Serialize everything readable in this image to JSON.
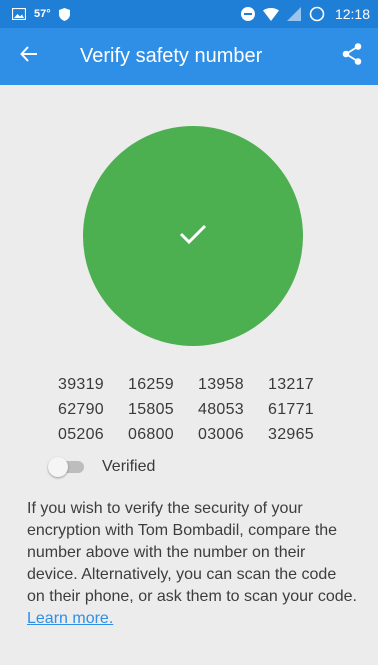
{
  "status_bar": {
    "temperature": "57°",
    "time": "12:18",
    "icons": [
      "image-icon",
      "shield-icon",
      "do-not-disturb-icon",
      "wifi-icon",
      "signal-icon",
      "battery-icon"
    ]
  },
  "app_bar": {
    "title": "Verify safety number",
    "back_icon": "arrow-back-icon",
    "share_icon": "share-icon",
    "color": "#2f8ee5"
  },
  "qr": {
    "state": "verified",
    "color": "#4caf50",
    "icon": "check-icon"
  },
  "safety_number": {
    "groups": [
      "39319",
      "16259",
      "13958",
      "13217",
      "62790",
      "15805",
      "48053",
      "61771",
      "05206",
      "06800",
      "03006",
      "32965"
    ]
  },
  "verified_toggle": {
    "label": "Verified",
    "checked": false
  },
  "description": {
    "text": "If you wish to verify the security of your encryption with Tom Bombadil, compare the number above with the number on their device. Alternatively, you can scan the code on their phone, or ask them to scan your code. ",
    "link_label": "Learn more."
  }
}
